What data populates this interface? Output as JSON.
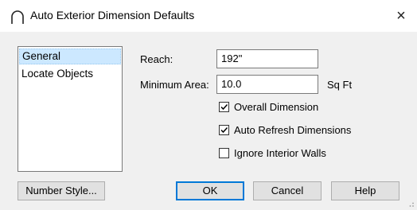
{
  "window": {
    "title": "Auto Exterior Dimension Defaults",
    "close_glyph": "×"
  },
  "sidebar": {
    "items": [
      {
        "label": "General",
        "selected": true
      },
      {
        "label": "Locate Objects",
        "selected": false
      }
    ]
  },
  "form": {
    "reach_label": "Reach:",
    "reach_value": "192\"",
    "min_area_label": "Minimum Area:",
    "min_area_value": "10.0",
    "min_area_unit": "Sq Ft"
  },
  "options": [
    {
      "label": "Overall Dimension",
      "checked": true
    },
    {
      "label": "Auto Refresh Dimensions",
      "checked": true
    },
    {
      "label": "Ignore Interior Walls",
      "checked": false
    }
  ],
  "buttons": {
    "number_style": "Number Style...",
    "ok": "OK",
    "cancel": "Cancel",
    "help": "Help"
  }
}
